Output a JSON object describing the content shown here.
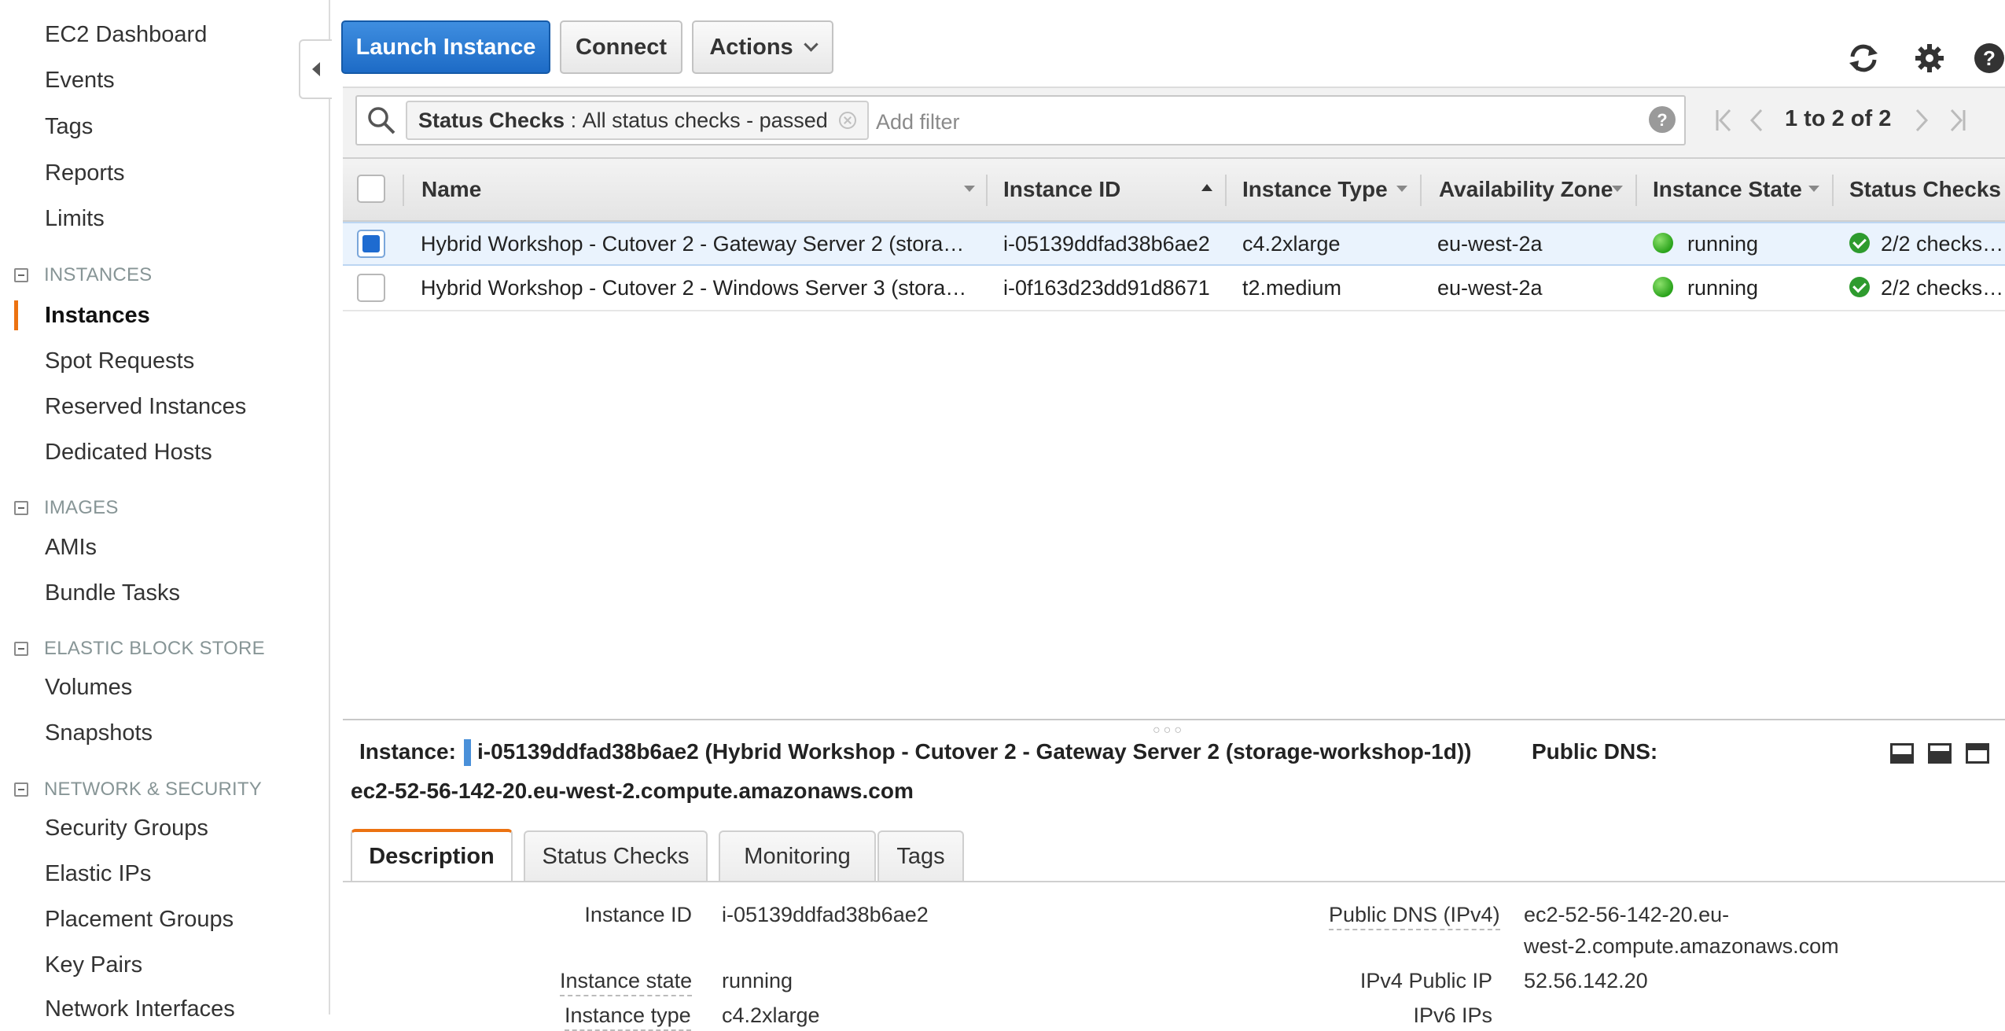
{
  "sidebar": {
    "top_items": [
      "EC2 Dashboard",
      "Events",
      "Tags",
      "Reports",
      "Limits"
    ],
    "sections": [
      {
        "title": "INSTANCES",
        "items": [
          "Instances",
          "Spot Requests",
          "Reserved Instances",
          "Dedicated Hosts"
        ]
      },
      {
        "title": "IMAGES",
        "items": [
          "AMIs",
          "Bundle Tasks"
        ]
      },
      {
        "title": "ELASTIC BLOCK STORE",
        "items": [
          "Volumes",
          "Snapshots"
        ]
      },
      {
        "title": "NETWORK & SECURITY",
        "items": [
          "Security Groups",
          "Elastic IPs",
          "Placement Groups",
          "Key Pairs",
          "Network Interfaces"
        ]
      }
    ],
    "active_item": "Instances"
  },
  "toolbar": {
    "launch_label": "Launch Instance",
    "connect_label": "Connect",
    "actions_label": "Actions",
    "icons": [
      "refresh-icon",
      "gear-icon",
      "help-icon"
    ]
  },
  "filter": {
    "token_key": "Status Checks",
    "token_sep": " : ",
    "token_value": "All status checks - passed",
    "placeholder": "Add filter",
    "pager": "1 to 2 of 2"
  },
  "table": {
    "columns": [
      "Name",
      "Instance ID",
      "Instance Type",
      "Availability Zone",
      "Instance State",
      "Status Checks"
    ],
    "rows": [
      {
        "name": "Hybrid Workshop - Cutover 2 - Gateway Server 2 (storag…",
        "id": "i-05139ddfad38b6ae2",
        "type": "c4.2xlarge",
        "zone": "eu-west-2a",
        "state": "running",
        "checks": "2/2 checks …",
        "selected": true
      },
      {
        "name": "Hybrid Workshop - Cutover 2 - Windows Server 3 (storag…",
        "id": "i-0f163d23dd91d8671",
        "type": "t2.medium",
        "zone": "eu-west-2a",
        "state": "running",
        "checks": "2/2 checks …",
        "selected": false
      }
    ]
  },
  "detail": {
    "instance_label": "Instance:",
    "instance_summary": "i-05139ddfad38b6ae2 (Hybrid Workshop - Cutover 2 - Gateway Server 2 (storage-workshop-1d))",
    "public_dns_label": "Public DNS:",
    "public_dns_value": "ec2-52-56-142-20.eu-west-2.compute.amazonaws.com",
    "tabs": [
      "Description",
      "Status Checks",
      "Monitoring",
      "Tags"
    ],
    "active_tab": "Description",
    "fields_left": [
      {
        "label": "Instance ID",
        "value": "i-05139ddfad38b6ae2"
      },
      {
        "label": "Instance state",
        "value": "running"
      },
      {
        "label": "Instance type",
        "value": "c4.2xlarge"
      }
    ],
    "fields_right": [
      {
        "label": "Public DNS (IPv4)",
        "value_line1": "ec2-52-56-142-20.eu-",
        "value_line2": "west-2.compute.amazonaws.com"
      },
      {
        "label": "IPv4 Public IP",
        "value": "52.56.142.20"
      },
      {
        "label": "IPv6 IPs",
        "value": ""
      }
    ]
  },
  "colors": {
    "primary": "#1d6bc6",
    "accent": "#ec7211",
    "running": "#2aa31b"
  }
}
